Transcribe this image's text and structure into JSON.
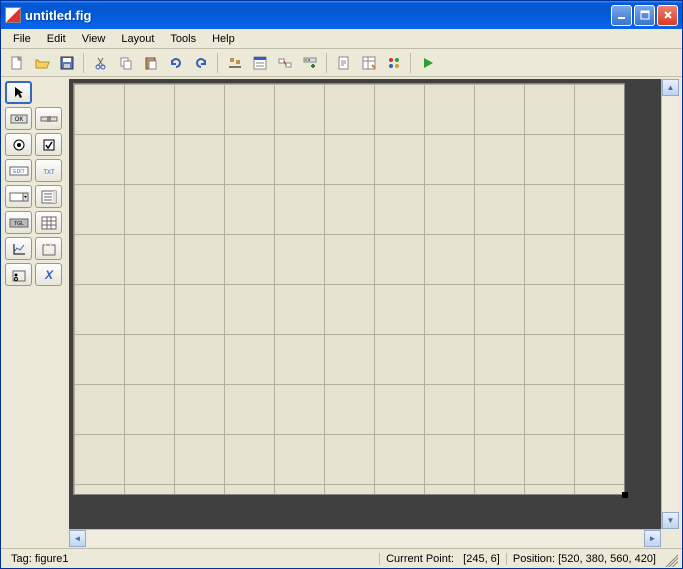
{
  "window": {
    "title": "untitled.fig"
  },
  "menus": [
    "File",
    "Edit",
    "View",
    "Layout",
    "Tools",
    "Help"
  ],
  "status": {
    "tag_label": "Tag:",
    "tag_value": "figure1",
    "point_label": "Current Point:",
    "point_value": "[245, 6]",
    "pos_label": "Position:",
    "pos_value": "[520, 380, 560, 420]"
  },
  "palette": {
    "select": "select",
    "ok": "OK",
    "slider": "slider",
    "radio": "radio",
    "check": "check",
    "edit": "EDIT",
    "txt": "TXT",
    "popup": "popup",
    "list": "list",
    "toggle": "TGL",
    "table": "table",
    "axes": "axes",
    "panel": "panel",
    "btngrp": "btngrp",
    "activex": "X"
  }
}
